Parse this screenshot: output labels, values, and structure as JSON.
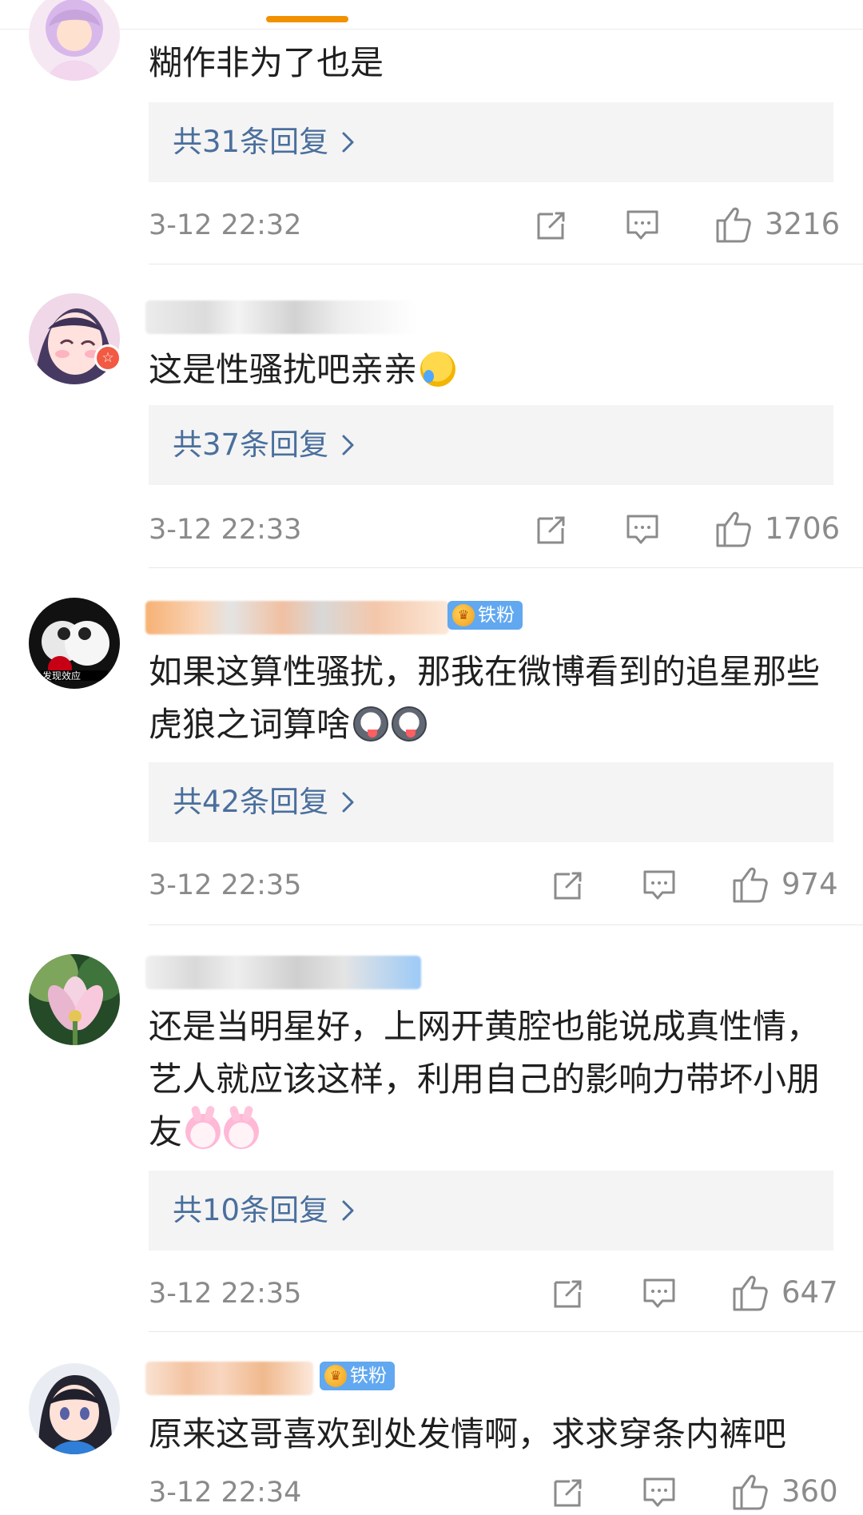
{
  "comments": [
    {
      "text": "糊作非为了也是",
      "reply_label": "共31条回复",
      "time": "3-12 22:32",
      "likes": "3216"
    },
    {
      "text": "这是性骚扰吧亲亲",
      "reply_label": "共37条回复",
      "time": "3-12 22:33",
      "likes": "1706"
    },
    {
      "badge": "铁粉",
      "text": "如果这算性骚扰，那我在微博看到的追星那些虎狼之词算啥",
      "reply_label": "共42条回复",
      "time": "3-12 22:35",
      "likes": "974"
    },
    {
      "text": "还是当明星好，上网开黄腔也能说成真性情，艺人就应该这样，利用自己的影响力带坏小朋友",
      "reply_label": "共10条回复",
      "time": "3-12 22:35",
      "likes": "647"
    },
    {
      "badge": "铁粉",
      "text": "原来这哥喜欢到处发情啊，求求穿条内裤吧",
      "time": "3-12 22:34",
      "likes": "360"
    }
  ],
  "colors": {
    "accent": "#f29100",
    "reply_link": "#4a6f9d",
    "fan_badge": "#61a8f0",
    "reply_bg": "#f4f4f4",
    "muted_text": "#8a8a8a"
  },
  "icons": [
    "share-icon",
    "comment-icon",
    "like-icon",
    "chevron-right-icon"
  ]
}
